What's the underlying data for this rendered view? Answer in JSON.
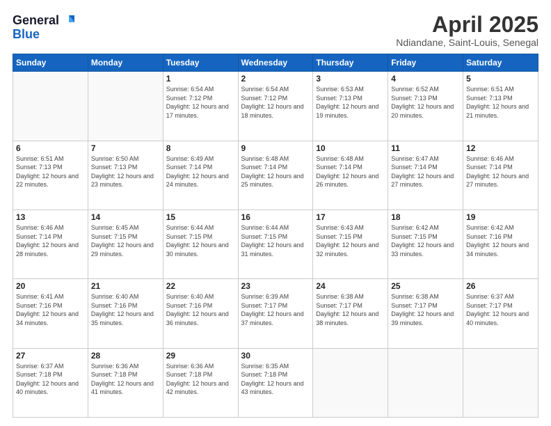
{
  "header": {
    "logo_general": "General",
    "logo_blue": "Blue",
    "month": "April 2025",
    "location": "Ndiandane, Saint-Louis, Senegal"
  },
  "weekdays": [
    "Sunday",
    "Monday",
    "Tuesday",
    "Wednesday",
    "Thursday",
    "Friday",
    "Saturday"
  ],
  "weeks": [
    [
      {
        "day": "",
        "info": ""
      },
      {
        "day": "",
        "info": ""
      },
      {
        "day": "1",
        "info": "Sunrise: 6:54 AM\nSunset: 7:12 PM\nDaylight: 12 hours and 17 minutes."
      },
      {
        "day": "2",
        "info": "Sunrise: 6:54 AM\nSunset: 7:12 PM\nDaylight: 12 hours and 18 minutes."
      },
      {
        "day": "3",
        "info": "Sunrise: 6:53 AM\nSunset: 7:13 PM\nDaylight: 12 hours and 19 minutes."
      },
      {
        "day": "4",
        "info": "Sunrise: 6:52 AM\nSunset: 7:13 PM\nDaylight: 12 hours and 20 minutes."
      },
      {
        "day": "5",
        "info": "Sunrise: 6:51 AM\nSunset: 7:13 PM\nDaylight: 12 hours and 21 minutes."
      }
    ],
    [
      {
        "day": "6",
        "info": "Sunrise: 6:51 AM\nSunset: 7:13 PM\nDaylight: 12 hours and 22 minutes."
      },
      {
        "day": "7",
        "info": "Sunrise: 6:50 AM\nSunset: 7:13 PM\nDaylight: 12 hours and 23 minutes."
      },
      {
        "day": "8",
        "info": "Sunrise: 6:49 AM\nSunset: 7:14 PM\nDaylight: 12 hours and 24 minutes."
      },
      {
        "day": "9",
        "info": "Sunrise: 6:48 AM\nSunset: 7:14 PM\nDaylight: 12 hours and 25 minutes."
      },
      {
        "day": "10",
        "info": "Sunrise: 6:48 AM\nSunset: 7:14 PM\nDaylight: 12 hours and 26 minutes."
      },
      {
        "day": "11",
        "info": "Sunrise: 6:47 AM\nSunset: 7:14 PM\nDaylight: 12 hours and 27 minutes."
      },
      {
        "day": "12",
        "info": "Sunrise: 6:46 AM\nSunset: 7:14 PM\nDaylight: 12 hours and 27 minutes."
      }
    ],
    [
      {
        "day": "13",
        "info": "Sunrise: 6:46 AM\nSunset: 7:14 PM\nDaylight: 12 hours and 28 minutes."
      },
      {
        "day": "14",
        "info": "Sunrise: 6:45 AM\nSunset: 7:15 PM\nDaylight: 12 hours and 29 minutes."
      },
      {
        "day": "15",
        "info": "Sunrise: 6:44 AM\nSunset: 7:15 PM\nDaylight: 12 hours and 30 minutes."
      },
      {
        "day": "16",
        "info": "Sunrise: 6:44 AM\nSunset: 7:15 PM\nDaylight: 12 hours and 31 minutes."
      },
      {
        "day": "17",
        "info": "Sunrise: 6:43 AM\nSunset: 7:15 PM\nDaylight: 12 hours and 32 minutes."
      },
      {
        "day": "18",
        "info": "Sunrise: 6:42 AM\nSunset: 7:15 PM\nDaylight: 12 hours and 33 minutes."
      },
      {
        "day": "19",
        "info": "Sunrise: 6:42 AM\nSunset: 7:16 PM\nDaylight: 12 hours and 34 minutes."
      }
    ],
    [
      {
        "day": "20",
        "info": "Sunrise: 6:41 AM\nSunset: 7:16 PM\nDaylight: 12 hours and 34 minutes."
      },
      {
        "day": "21",
        "info": "Sunrise: 6:40 AM\nSunset: 7:16 PM\nDaylight: 12 hours and 35 minutes."
      },
      {
        "day": "22",
        "info": "Sunrise: 6:40 AM\nSunset: 7:16 PM\nDaylight: 12 hours and 36 minutes."
      },
      {
        "day": "23",
        "info": "Sunrise: 6:39 AM\nSunset: 7:17 PM\nDaylight: 12 hours and 37 minutes."
      },
      {
        "day": "24",
        "info": "Sunrise: 6:38 AM\nSunset: 7:17 PM\nDaylight: 12 hours and 38 minutes."
      },
      {
        "day": "25",
        "info": "Sunrise: 6:38 AM\nSunset: 7:17 PM\nDaylight: 12 hours and 39 minutes."
      },
      {
        "day": "26",
        "info": "Sunrise: 6:37 AM\nSunset: 7:17 PM\nDaylight: 12 hours and 40 minutes."
      }
    ],
    [
      {
        "day": "27",
        "info": "Sunrise: 6:37 AM\nSunset: 7:18 PM\nDaylight: 12 hours and 40 minutes."
      },
      {
        "day": "28",
        "info": "Sunrise: 6:36 AM\nSunset: 7:18 PM\nDaylight: 12 hours and 41 minutes."
      },
      {
        "day": "29",
        "info": "Sunrise: 6:36 AM\nSunset: 7:18 PM\nDaylight: 12 hours and 42 minutes."
      },
      {
        "day": "30",
        "info": "Sunrise: 6:35 AM\nSunset: 7:18 PM\nDaylight: 12 hours and 43 minutes."
      },
      {
        "day": "",
        "info": ""
      },
      {
        "day": "",
        "info": ""
      },
      {
        "day": "",
        "info": ""
      }
    ]
  ]
}
